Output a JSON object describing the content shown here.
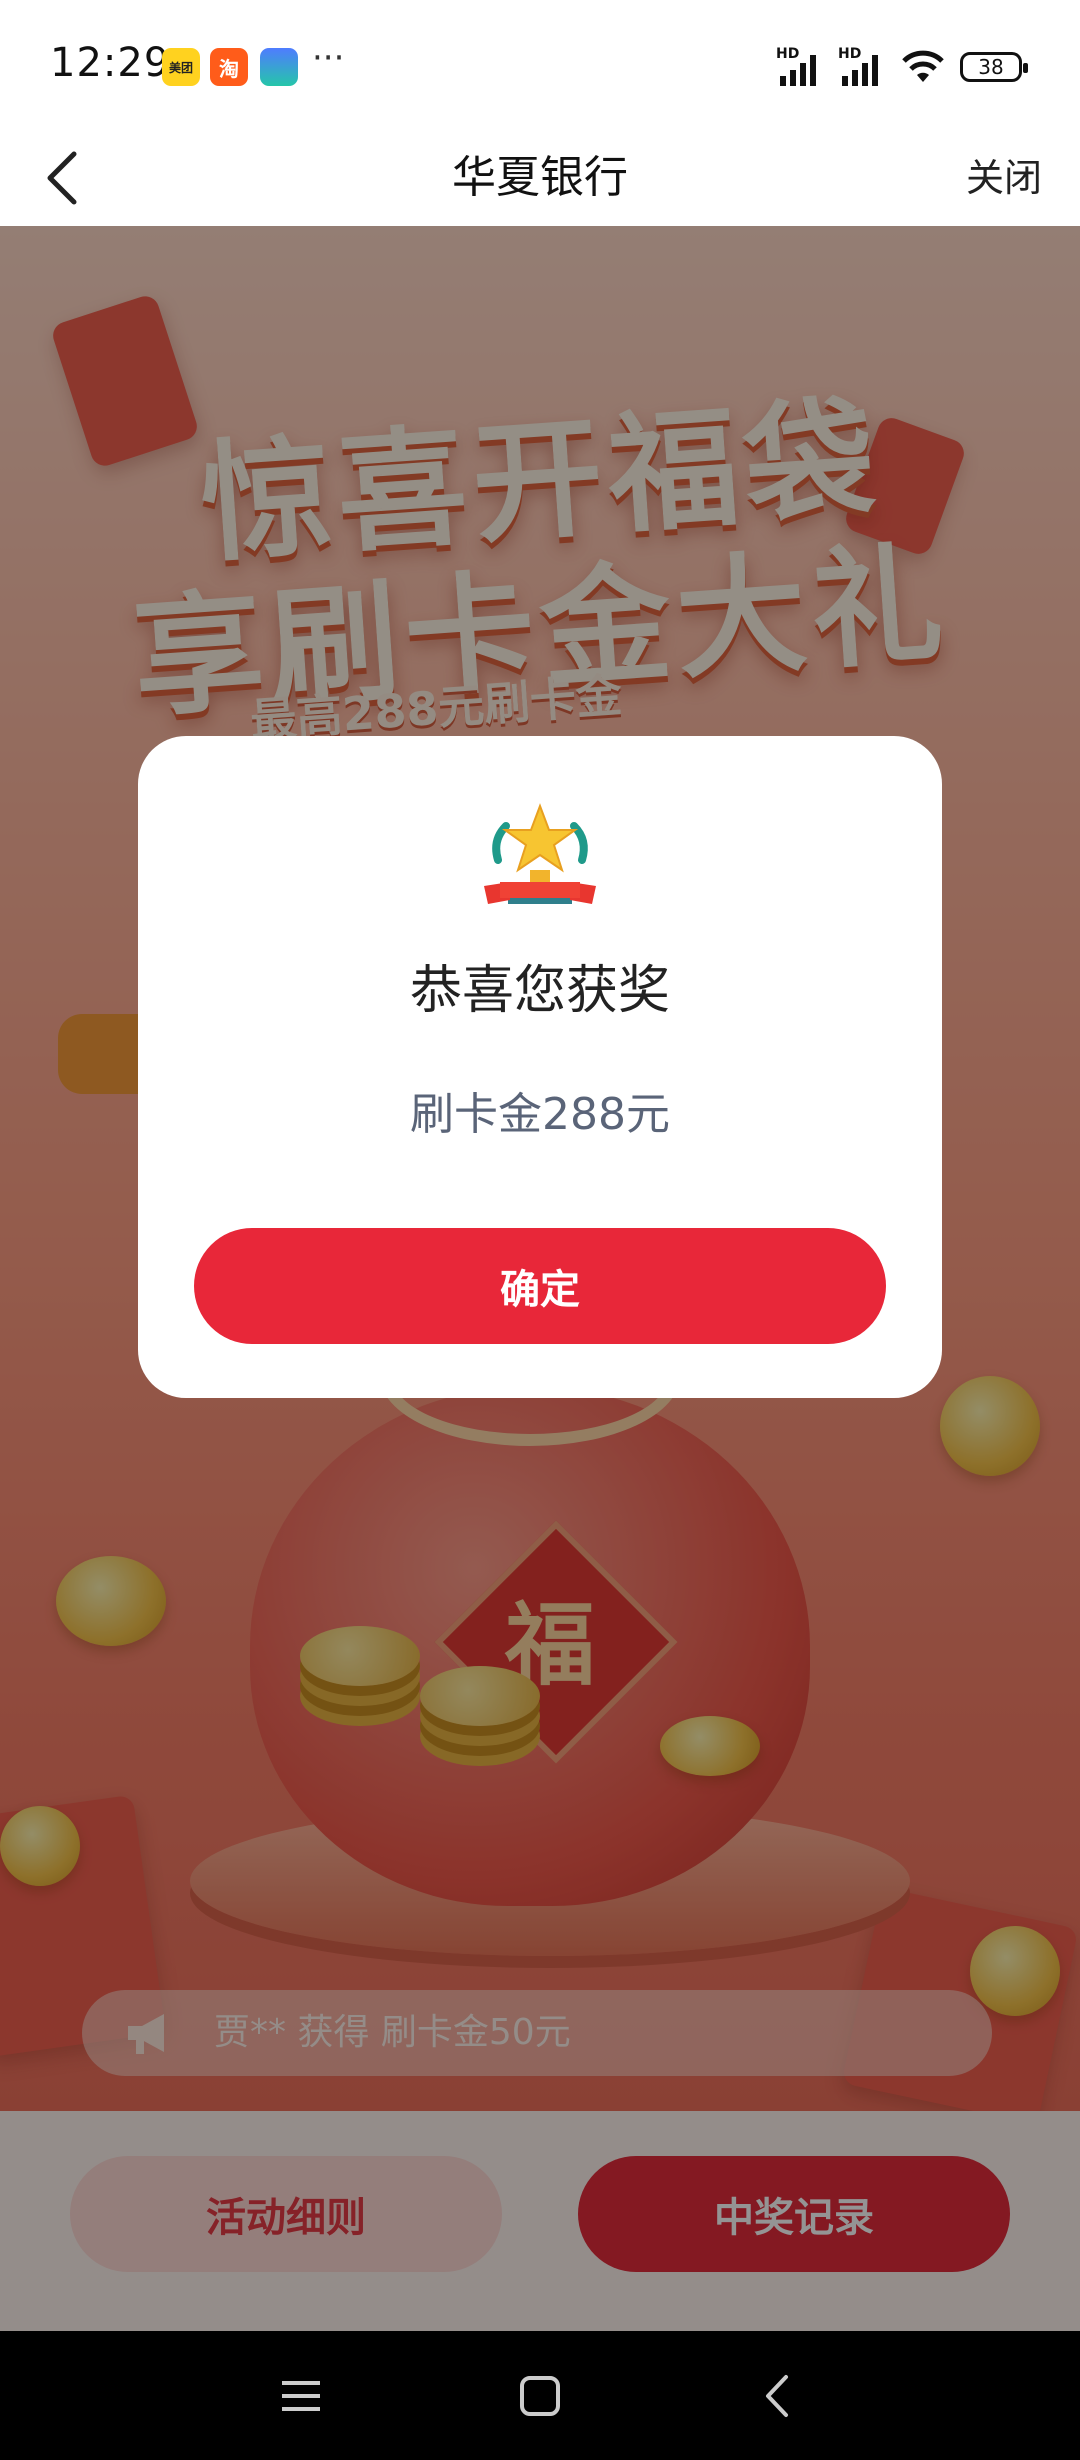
{
  "status_bar": {
    "time": "12:29",
    "app_badges": [
      {
        "name": "meituan-app-badge",
        "text": "美团"
      },
      {
        "name": "taobao-app-badge",
        "text": "淘"
      },
      {
        "name": "cards-app-badge",
        "text": ""
      }
    ],
    "more": "···",
    "signal_1_label": "HD",
    "signal_2_label": "HD",
    "battery": "38"
  },
  "nav": {
    "back_icon": "chevron-left-icon",
    "title": "华夏银行",
    "close_label": "关闭"
  },
  "campaign": {
    "headline_1": "惊喜开福袋",
    "headline_2": "享刷卡金大礼",
    "subline": "最高288元刷卡金",
    "bag_char": "福",
    "marquee_text": "贾** 获得 刷卡金50元"
  },
  "actions": {
    "rules_label": "活动细则",
    "records_label": "中奖记录"
  },
  "modal": {
    "icon": "trophy-icon",
    "title": "恭喜您获奖",
    "prize": "刷卡金288元",
    "confirm_label": "确定"
  },
  "system_nav": {
    "menu_icon": "menu-icon",
    "home_icon": "home-square-icon",
    "back_icon": "back-triangle-icon"
  },
  "colors": {
    "primary_red": "#e82739",
    "overlay": "rgba(0,0,0,0.42)"
  }
}
